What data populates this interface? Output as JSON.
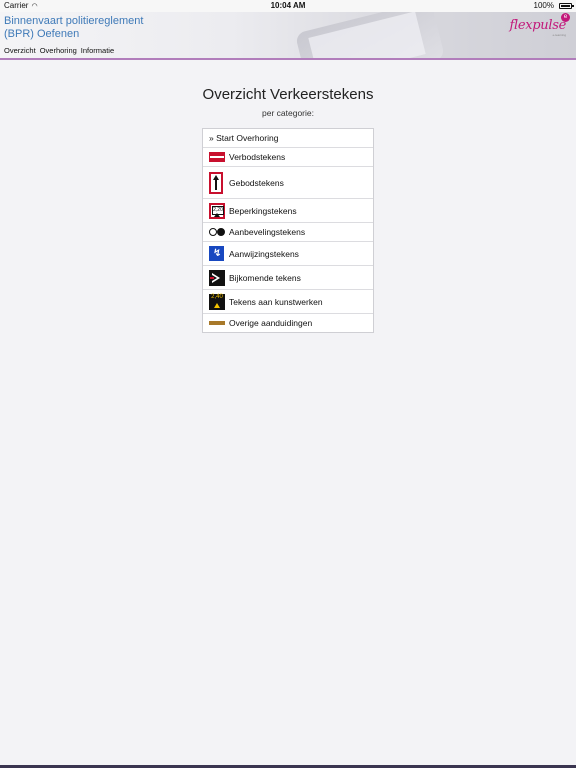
{
  "statusbar": {
    "carrier": "Carrier",
    "time": "10:04 AM",
    "battery": "100%"
  },
  "header": {
    "title_line1": "Binnenvaart politiereglement",
    "title_line2": "(BPR) Oefenen",
    "logo_text": "flexpulse",
    "logo_tag": "e-learning"
  },
  "nav": {
    "items": [
      {
        "label": "Overzicht"
      },
      {
        "label": "Overhoring"
      },
      {
        "label": "Informatie"
      }
    ]
  },
  "main": {
    "title": "Overzicht Verkeerstekens",
    "subtitle": "per categorie:"
  },
  "list": {
    "items": [
      {
        "label": "» Start Overhoring",
        "icon": "none"
      },
      {
        "label": "Verbodstekens",
        "icon": "prohibition-sign-icon"
      },
      {
        "label": "Gebodstekens",
        "icon": "mandatory-arrow-sign-icon"
      },
      {
        "label": "Beperkingstekens",
        "icon": "restriction-sign-icon"
      },
      {
        "label": "Aanbevelingstekens",
        "icon": "recommendation-lights-icon"
      },
      {
        "label": "Aanwijzingstekens",
        "icon": "indication-sign-icon"
      },
      {
        "label": "Bijkomende tekens",
        "icon": "supplementary-sign-icon"
      },
      {
        "label": "Tekens aan kunstwerken",
        "icon": "structure-sign-icon"
      },
      {
        "label": "Overige aanduidingen",
        "icon": "other-marking-icon"
      }
    ]
  },
  "icons": {
    "beperk_plate": "2,20",
    "kunst_plate": "2,40"
  },
  "colors": {
    "title_blue": "#3f7ab8",
    "brand_magenta": "#c2187a",
    "nav_rule": "#b17dbb",
    "sign_red": "#c8102e",
    "sign_blue": "#1848c0"
  }
}
